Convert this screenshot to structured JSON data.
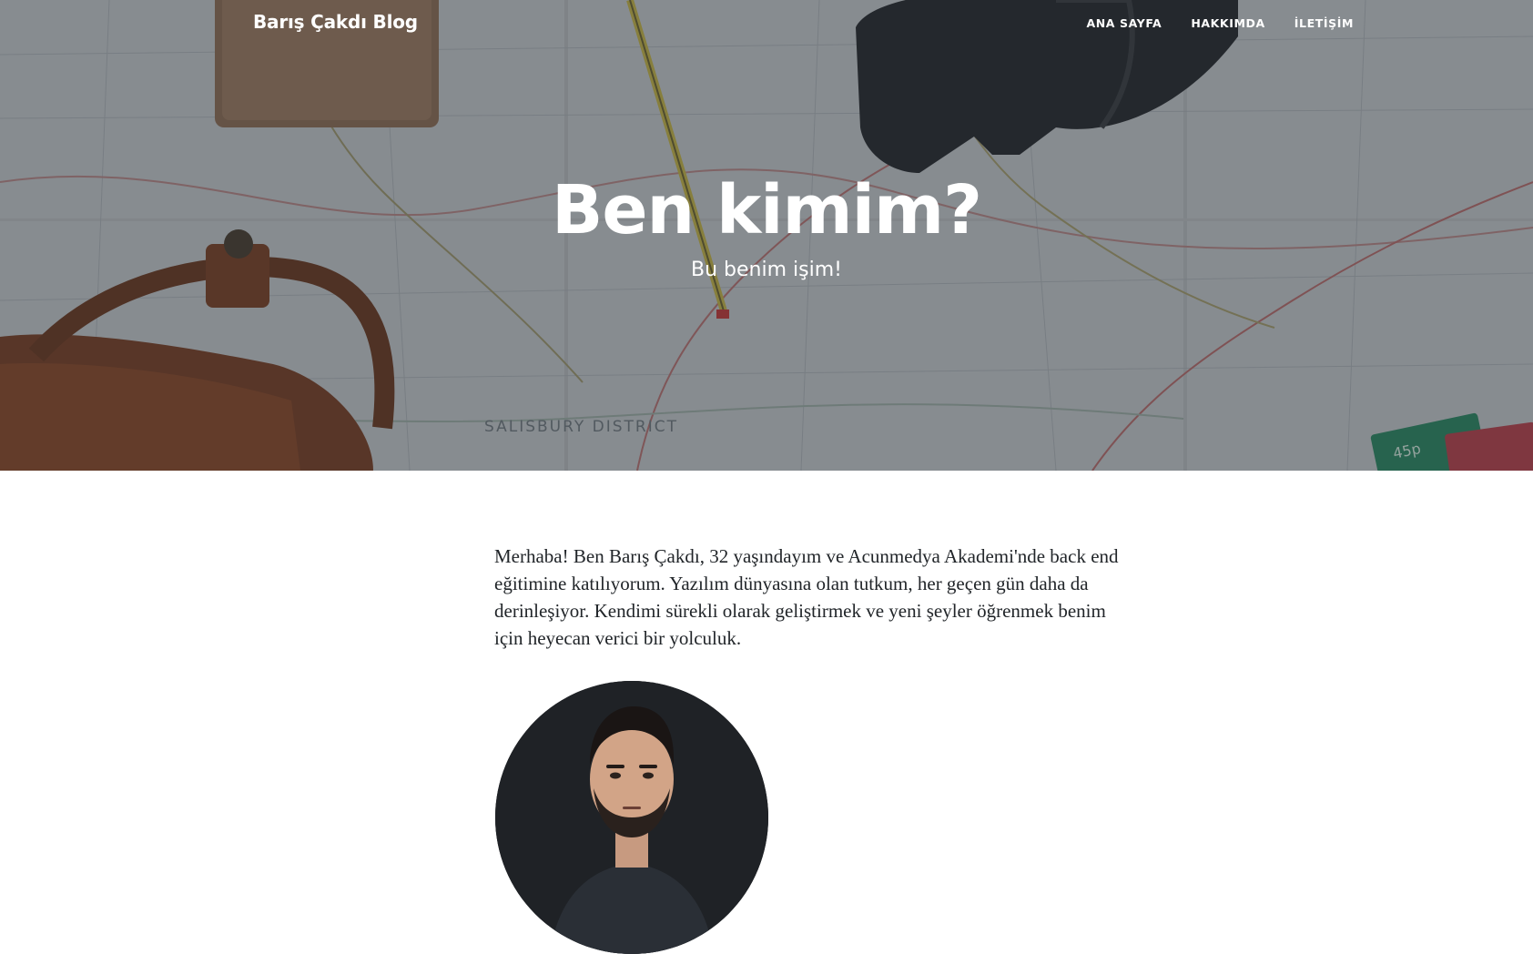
{
  "navbar": {
    "brand": "Barış Çakdı Blog",
    "links": [
      {
        "label": "ANA SAYFA"
      },
      {
        "label": "HAKKIMDA"
      },
      {
        "label": "İLETİŞİM"
      }
    ]
  },
  "hero": {
    "title": "Ben kimim?",
    "subtitle": "Bu benim işim!",
    "map_labels": {
      "district": "SALISBURY DISTRICT",
      "stamp": "45p"
    }
  },
  "content": {
    "intro": "Merhaba! Ben Barış Çakdı, 32 yaşındayım ve Acunmedya Akademi'nde back end eğitimine katılıyorum. Yazılım dünyasına olan tutkum, her geçen gün daha da derinleşiyor. Kendimi sürekli olarak geliştirmek ve yeni şeyler öğrenmek benim için heyecan verici bir yolculuk."
  },
  "colors": {
    "overlay": "#212529",
    "text": "#212529",
    "nav_text": "#ffffff",
    "map_base": "#c9ced1"
  }
}
